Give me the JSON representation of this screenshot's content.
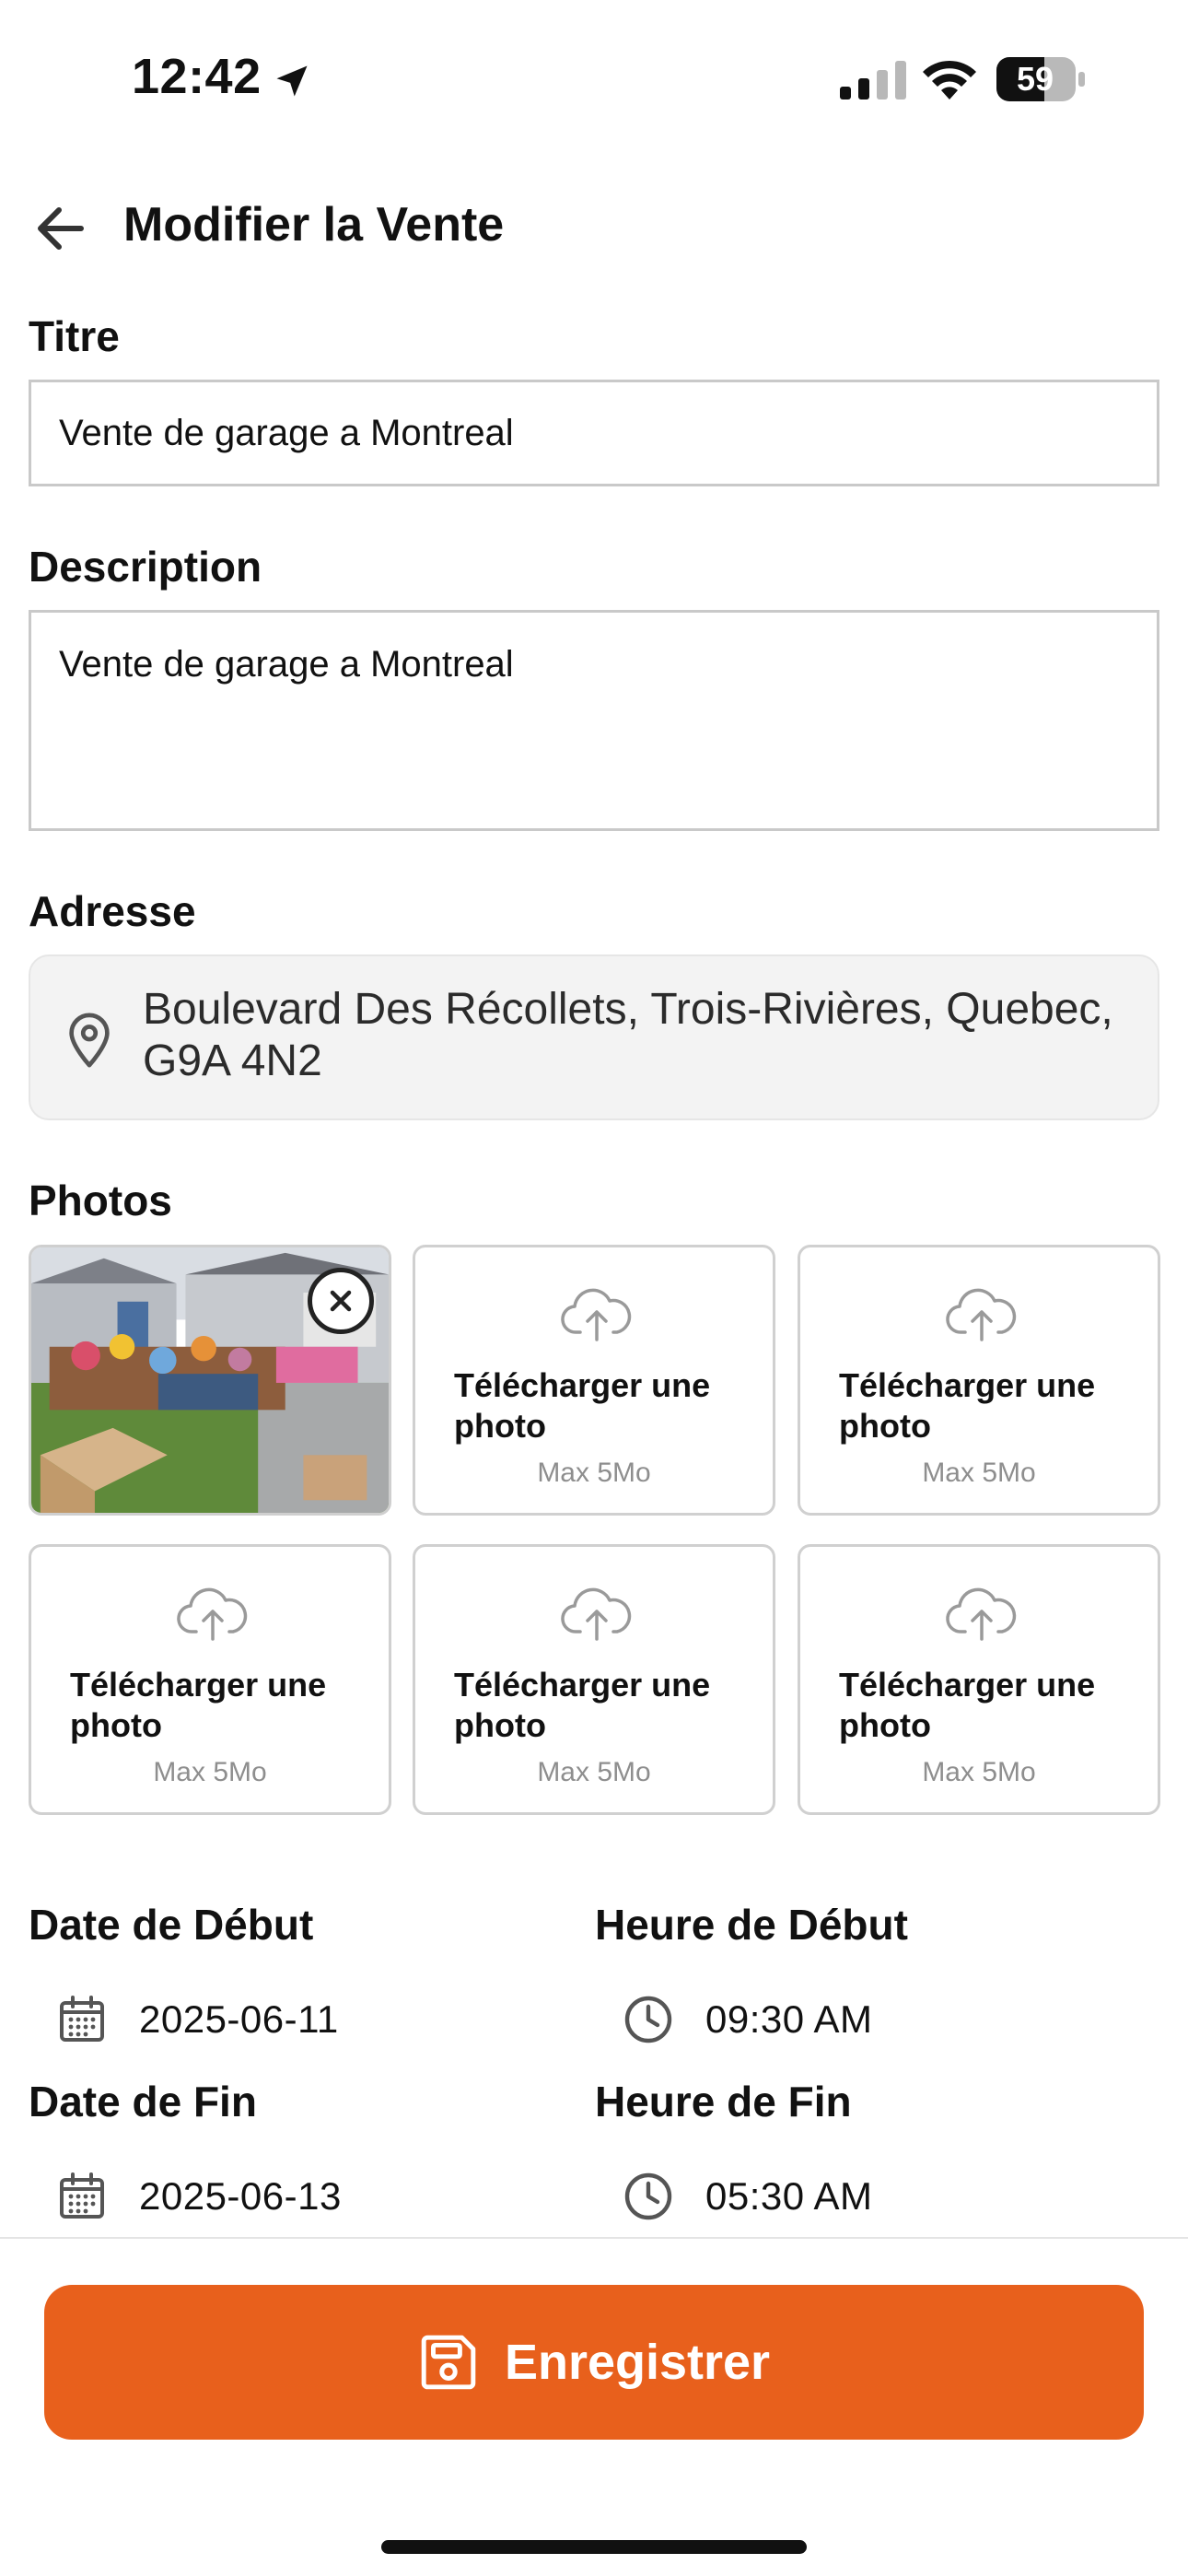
{
  "status_bar": {
    "time": "12:42",
    "battery": "59"
  },
  "header": {
    "title": "Modifier la Vente"
  },
  "form": {
    "title_label": "Titre",
    "title_value": "Vente de garage a Montreal",
    "description_label": "Description",
    "description_value": "Vente de garage a Montreal",
    "address_label": "Adresse",
    "address_value": "Boulevard Des Récollets, Trois-Rivières, Quebec, G9A 4N2",
    "photos_label": "Photos",
    "upload_label": "Télécharger une photo",
    "upload_sub": "Max 5Mo",
    "start_date_label": "Date de Début",
    "start_date_value": "2025-06-11",
    "start_time_label": "Heure de Début",
    "start_time_value": "09:30 AM",
    "end_date_label": "Date de Fin",
    "end_date_value": "2025-06-13",
    "end_time_label": "Heure de Fin",
    "end_time_value": "05:30 AM"
  },
  "footer": {
    "save_label": "Enregistrer"
  },
  "colors": {
    "accent": "#e8601c"
  }
}
